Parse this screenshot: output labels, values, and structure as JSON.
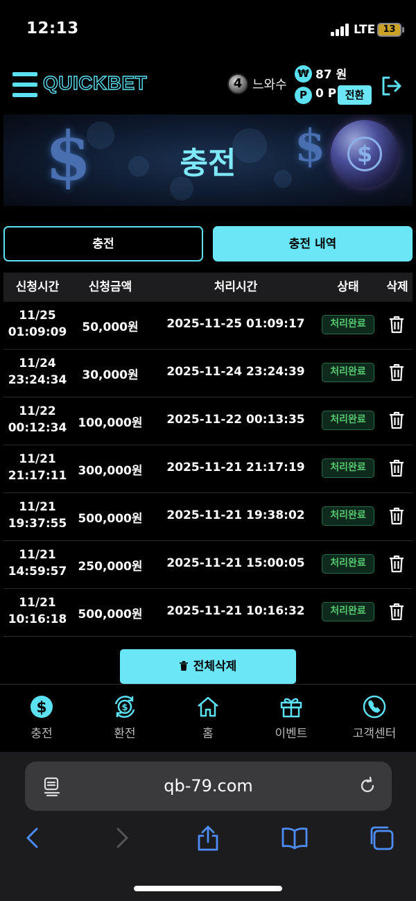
{
  "status_bar": {
    "time": "12:13",
    "network": "LTE",
    "battery": "13"
  },
  "header": {
    "logo": "QUICKBET",
    "level": "4",
    "username": "느와수",
    "won_symbol": "₩",
    "money": "87 원",
    "point_symbol": "P",
    "points": "0 P",
    "convert_label": "전환"
  },
  "banner": {
    "title": "충전"
  },
  "tabs": [
    {
      "label": "충전",
      "active": false
    },
    {
      "label": "충전 내역",
      "active": true
    }
  ],
  "table": {
    "headers": [
      "신청시간",
      "신청금액",
      "처리시간",
      "상태",
      "삭제"
    ],
    "rows": [
      {
        "date": "11/25",
        "time": "01:09:09",
        "amount": "50,000원",
        "processed": "2025-11-25 01:09:17",
        "status": "처리완료"
      },
      {
        "date": "11/24",
        "time": "23:24:34",
        "amount": "30,000원",
        "processed": "2025-11-24 23:24:39",
        "status": "처리완료"
      },
      {
        "date": "11/22",
        "time": "00:12:34",
        "amount": "100,000원",
        "processed": "2025-11-22 00:13:35",
        "status": "처리완료"
      },
      {
        "date": "11/21",
        "time": "21:17:11",
        "amount": "300,000원",
        "processed": "2025-11-21 21:17:19",
        "status": "처리완료"
      },
      {
        "date": "11/21",
        "time": "19:37:55",
        "amount": "500,000원",
        "processed": "2025-11-21 19:38:02",
        "status": "처리완료"
      },
      {
        "date": "11/21",
        "time": "14:59:57",
        "amount": "250,000원",
        "processed": "2025-11-21 15:00:05",
        "status": "처리완료"
      },
      {
        "date": "11/21",
        "time": "10:16:18",
        "amount": "500,000원",
        "processed": "2025-11-21 10:16:32",
        "status": "처리완료"
      }
    ]
  },
  "delete_all_label": "전체삭제",
  "bottom_nav": [
    {
      "label": "충전",
      "icon": "dollar-coin-icon"
    },
    {
      "label": "환전",
      "icon": "exchange-coin-icon"
    },
    {
      "label": "홈",
      "icon": "home-icon"
    },
    {
      "label": "이벤트",
      "icon": "gift-icon"
    },
    {
      "label": "고객센터",
      "icon": "phone-icon"
    }
  ],
  "browser": {
    "url": "qb-79.com"
  },
  "colors": {
    "accent": "#5ce1f2",
    "button": "#6ae6f7",
    "status_green": "#56c96e",
    "background": "#000000"
  }
}
